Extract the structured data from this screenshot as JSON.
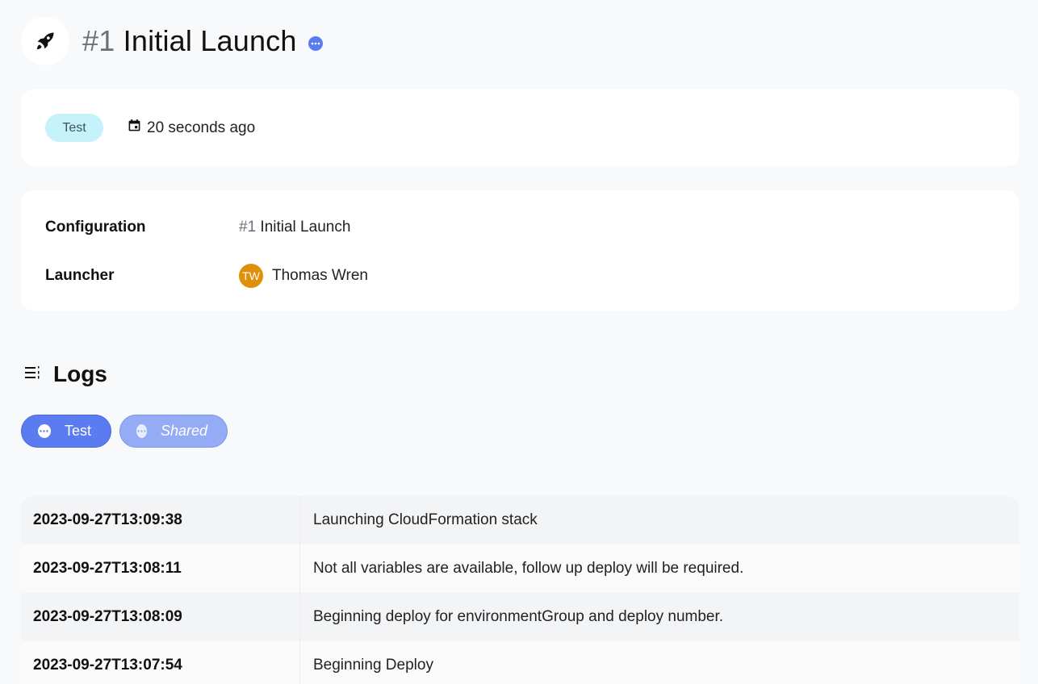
{
  "header": {
    "number": "#1",
    "title": "Initial Launch",
    "icon": "rocket-icon",
    "status_icon": "more-dots-icon"
  },
  "meta": {
    "environment_tag": "Test",
    "created": "20 seconds ago",
    "calendar_icon": "calendar-icon"
  },
  "info": {
    "configuration_label": "Configuration",
    "configuration_number": "#1",
    "configuration_name": "Initial Launch",
    "launcher_label": "Launcher",
    "launcher_initials": "TW",
    "launcher_name": "Thomas Wren"
  },
  "logs": {
    "title": "Logs",
    "icon": "list-icon",
    "filters": [
      {
        "label": "Test",
        "active": true
      },
      {
        "label": "Shared",
        "active": false
      }
    ],
    "rows": [
      {
        "timestamp": "2023-09-27T13:09:38",
        "message": "Launching CloudFormation stack"
      },
      {
        "timestamp": "2023-09-27T13:08:11",
        "message": "Not all variables are available, follow up deploy will be required."
      },
      {
        "timestamp": "2023-09-27T13:08:09",
        "message": "Beginning deploy for environmentGroup and deploy number."
      },
      {
        "timestamp": "2023-09-27T13:07:54",
        "message": "Beginning Deploy"
      }
    ]
  },
  "colors": {
    "accent": "#5b7cf0",
    "tag_bg": "#c6f2fb",
    "avatar_bg": "#e08f0b",
    "page_bg": "#f8f9fb"
  }
}
